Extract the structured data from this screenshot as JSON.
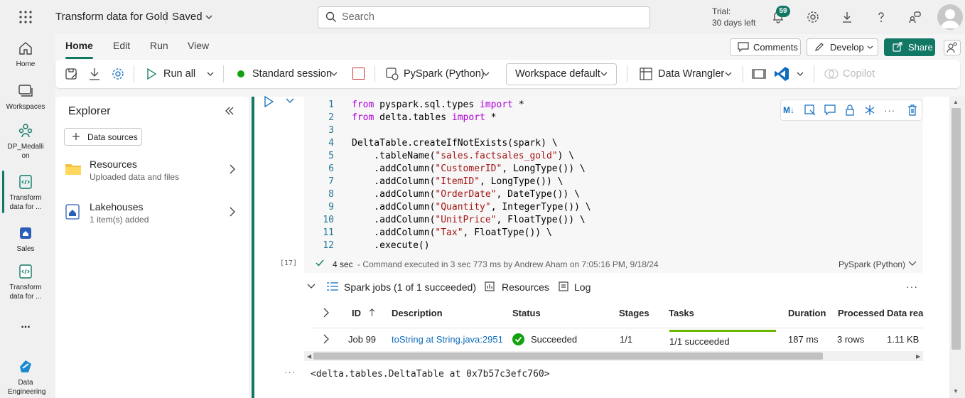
{
  "header": {
    "title": "Transform data for Gold",
    "saved": "Saved",
    "search_placeholder": "Search",
    "trial_line1": "Trial:",
    "trial_line2": "30 days left",
    "notification_count": "59"
  },
  "rail": {
    "items": [
      {
        "label": "Home",
        "icon": "home-icon"
      },
      {
        "label": "Workspaces",
        "icon": "workspaces-icon"
      },
      {
        "label": "DP_Medallion",
        "icon": "people-icon"
      },
      {
        "label": "Transform data for ...",
        "icon": "notebook-icon"
      },
      {
        "label": "Sales",
        "icon": "lakehouse-icon"
      },
      {
        "label": "Transform data for ...",
        "icon": "notebook-icon"
      },
      {
        "label": "...",
        "icon": "more-icon"
      },
      {
        "label": "Data Engineering",
        "icon": "data-engineering-icon"
      }
    ]
  },
  "tabs": [
    "Home",
    "Edit",
    "Run",
    "View"
  ],
  "top_buttons": {
    "comments": "Comments",
    "develop": "Develop",
    "share": "Share"
  },
  "toolbar": {
    "run_all": "Run all",
    "session": "Standard session",
    "language": "PySpark (Python)",
    "environment": "Workspace default",
    "data_wrangler": "Data Wrangler",
    "copilot": "Copilot"
  },
  "explorer": {
    "title": "Explorer",
    "data_sources": "Data sources",
    "items": [
      {
        "title": "Resources",
        "subtitle": "Uploaded data and files"
      },
      {
        "title": "Lakehouses",
        "subtitle": "1 item(s) added"
      }
    ]
  },
  "cell": {
    "execution_count": "[17]",
    "lines": [
      "1",
      "2",
      "3",
      "4",
      "5",
      "6",
      "7",
      "8",
      "9",
      "10",
      "11",
      "12"
    ],
    "status_duration": "4 sec",
    "status_text": "- Command executed in 3 sec 773 ms by Andrew Aham on 7:05:16 PM, 9/18/24",
    "language": "PySpark (Python)",
    "spark_jobs": "Spark jobs (1 of 1 succeeded)",
    "resources": "Resources",
    "log": "Log",
    "output": "<delta.tables.DeltaTable at 0x7b57c3efc760>"
  },
  "jobs_table": {
    "headers": {
      "id": "ID",
      "description": "Description",
      "status": "Status",
      "stages": "Stages",
      "tasks": "Tasks",
      "duration": "Duration",
      "processed": "Processed",
      "data_read": "Data rea"
    },
    "row": {
      "id": "Job 99",
      "description": "toString at String.java:2951",
      "status": "Succeeded",
      "stages": "1/1",
      "tasks": "1/1 succeeded",
      "tasks_progress": 1.0,
      "duration": "187 ms",
      "processed": "3 rows",
      "data_read": "1.11 KB"
    }
  },
  "colors": {
    "accent": "#117865",
    "link": "#0f6cbd",
    "success": "#13a10e"
  }
}
